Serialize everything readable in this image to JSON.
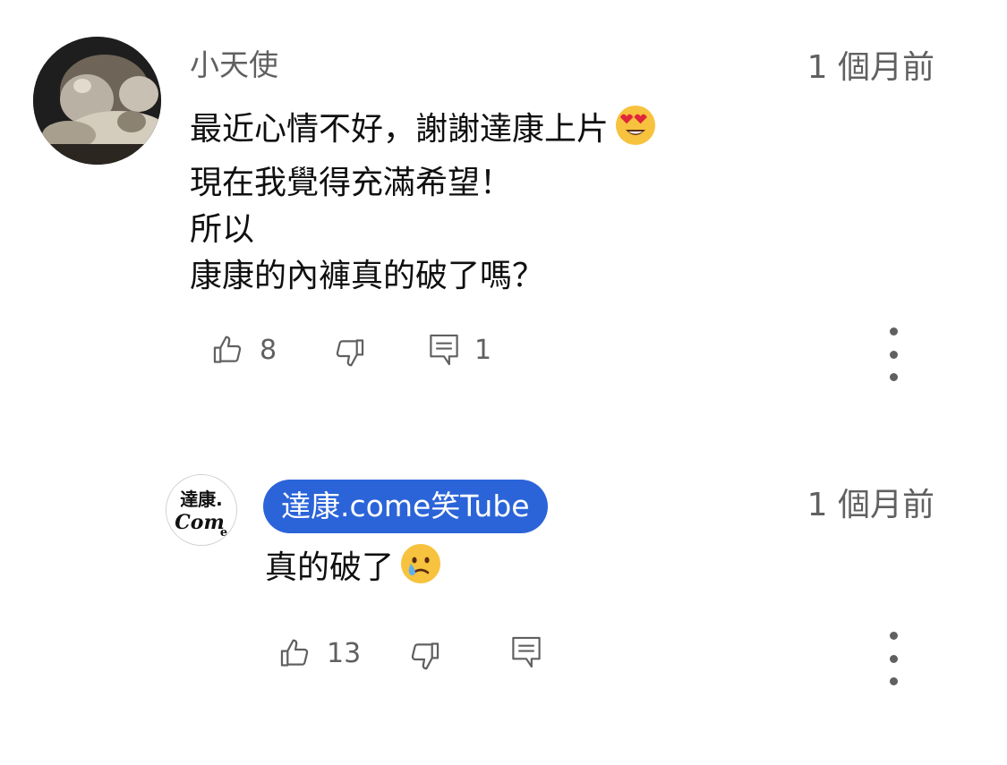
{
  "comment": {
    "author": "小天使",
    "time": "1 個月前",
    "lines": [
      "最近心情不好，謝謝達康上片",
      "現在我覺得充滿希望！",
      "所以",
      "康康的內褲真的破了嗎？"
    ],
    "emoji": "heart-eyes-emoji",
    "likes": "8",
    "replies": "1"
  },
  "reply": {
    "author": "達康.come笑Tube",
    "avatar_text": [
      "達康.",
      "Come"
    ],
    "time": "1 個月前",
    "text": "真的破了",
    "emoji": "crying-face-emoji",
    "likes": "13"
  },
  "colors": {
    "text": "#0f0f0f",
    "secondary": "#606060",
    "creator_badge": "#2b64d8"
  }
}
